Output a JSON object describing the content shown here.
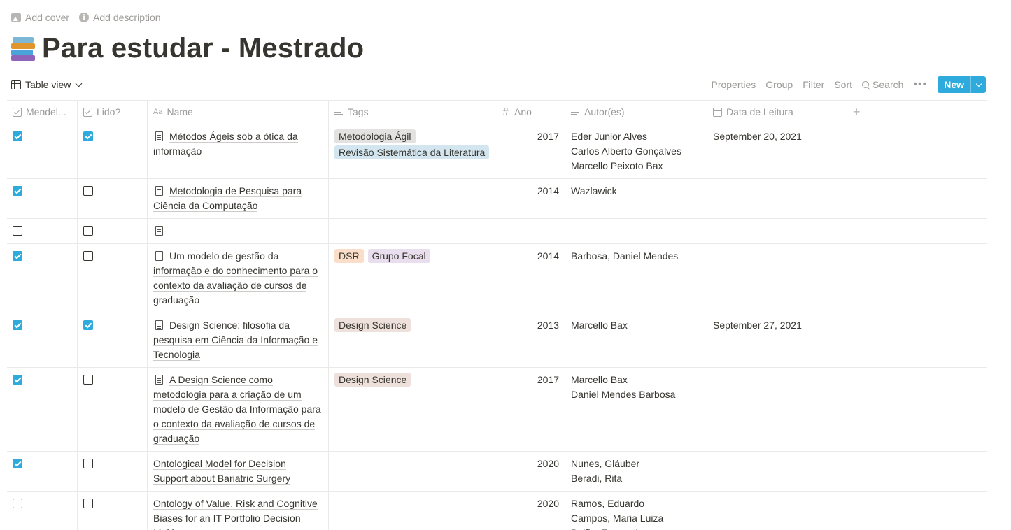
{
  "header": {
    "add_cover": "Add cover",
    "add_description": "Add description",
    "title": "Para estudar - Mestrado",
    "icon": "books-emoji-icon"
  },
  "toolbar": {
    "view_label": "Table view",
    "properties": "Properties",
    "group": "Group",
    "filter": "Filter",
    "sort": "Sort",
    "search": "Search",
    "more": "•••",
    "new": "New"
  },
  "columns": {
    "mendeley": "Mendel...",
    "lido": "Lido?",
    "name": "Name",
    "tags": "Tags",
    "ano": "Ano",
    "autores": "Autor(es)",
    "data": "Data de Leitura",
    "add": "+"
  },
  "colors": {
    "accent": "#2eaadc",
    "tag_gray": "#e3e2e0",
    "tag_blue": "#d3e5ef",
    "tag_orange": "#fadec9",
    "tag_purple": "#e8deee",
    "tag_brown": "#eee0da"
  },
  "rows": [
    {
      "mendeley": true,
      "lido": true,
      "doc_icon": true,
      "name": "Métodos Ágeis sob a ótica da informação",
      "tags": [
        {
          "label": "Metodologia Ágil",
          "color": "#e3e2e0"
        },
        {
          "label": "Revisão Sistemática da Literatura",
          "color": "#d3e5ef"
        }
      ],
      "ano": "2017",
      "autores": [
        "Eder Junior Alves",
        "Carlos Alberto Gonçalves",
        "Marcello Peixoto Bax"
      ],
      "data": "September 20, 2021"
    },
    {
      "mendeley": true,
      "lido": false,
      "doc_icon": true,
      "name": "Metodologia de Pesquisa para Ciência da Computação",
      "tags": [],
      "ano": "2014",
      "autores": [
        "Wazlawick"
      ],
      "data": ""
    },
    {
      "mendeley": false,
      "lido": false,
      "doc_icon": true,
      "name": "",
      "tags": [],
      "ano": "",
      "autores": [],
      "data": ""
    },
    {
      "mendeley": true,
      "lido": false,
      "doc_icon": true,
      "name": "Um modelo de gestão da informação e do conhecimento para o contexto da avaliação de cursos de graduação",
      "tags": [
        {
          "label": "DSR",
          "color": "#fadec9"
        },
        {
          "label": "Grupo Focal",
          "color": "#e8deee"
        }
      ],
      "ano": "2014",
      "autores": [
        "Barbosa, Daniel Mendes"
      ],
      "data": ""
    },
    {
      "mendeley": true,
      "lido": true,
      "doc_icon": true,
      "name": "Design Science: filosofia da pesquisa em Ciência da Informação e Tecnologia",
      "tags": [
        {
          "label": "Design Science",
          "color": "#eee0da"
        }
      ],
      "ano": "2013",
      "autores": [
        "Marcello Bax"
      ],
      "data": "September 27, 2021"
    },
    {
      "mendeley": true,
      "lido": false,
      "doc_icon": true,
      "name": "A Design Science como metodologia para a criação de um modelo de Gestão da Informação para o contexto da avaliação de cursos de graduação",
      "tags": [
        {
          "label": "Design Science",
          "color": "#eee0da"
        }
      ],
      "ano": "2017",
      "autores": [
        "Marcello Bax",
        "Daniel Mendes Barbosa"
      ],
      "data": ""
    },
    {
      "mendeley": true,
      "lido": false,
      "doc_icon": false,
      "name": "Ontological Model for Decision Support about Bariatric Surgery",
      "tags": [],
      "ano": "2020",
      "autores": [
        "Nunes, Gláuber",
        "Beradi, Rita"
      ],
      "data": ""
    },
    {
      "mendeley": false,
      "lido": false,
      "doc_icon": false,
      "name": "Ontology of Value, Risk and Cognitive Biases for an IT Portfolio Decision Making",
      "tags": [],
      "ano": "2020",
      "autores": [
        "Ramos, Eduardo",
        "Campos, Maria Luiza",
        "Baião, Fernanda"
      ],
      "data": ""
    }
  ]
}
